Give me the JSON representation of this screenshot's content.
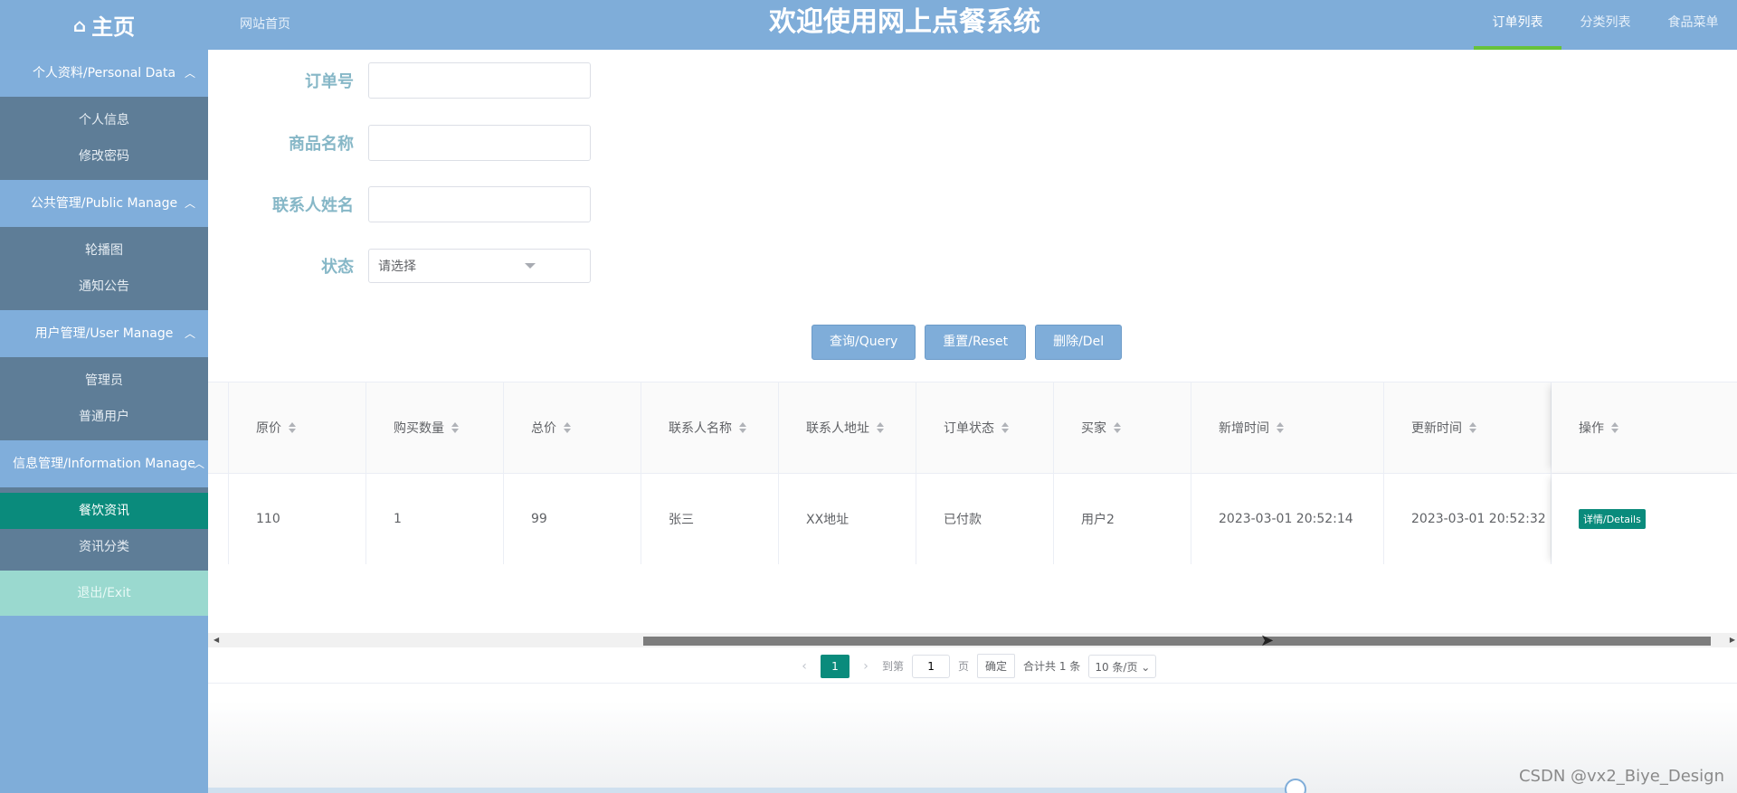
{
  "header": {
    "brand": "主页",
    "brand_icon": "home-icon",
    "site_link": "网站首页",
    "title": "欢迎使用网上点餐系统",
    "nav": [
      "订单列表",
      "分类列表",
      "食品菜单"
    ],
    "active_nav": "订单列表"
  },
  "sidebar": {
    "groups": [
      {
        "title": "个人资料/Personal Data",
        "items": [
          "个人信息",
          "修改密码"
        ]
      },
      {
        "title": "公共管理/Public Manage",
        "items": [
          "轮播图",
          "通知公告"
        ]
      },
      {
        "title": "用户管理/User Manage",
        "items": [
          "管理员",
          "普通用户"
        ]
      },
      {
        "title": "信息管理/Information Manage",
        "items": [
          "餐饮资讯",
          "资讯分类"
        ]
      }
    ],
    "active_item": "餐饮资讯",
    "exit": "退出/Exit"
  },
  "search": {
    "order_no_label": "订单号",
    "order_no_value": "",
    "product_label": "商品名称",
    "product_value": "",
    "contact_label": "联系人姓名",
    "contact_value": "",
    "status_label": "状态",
    "status_placeholder": "请选择"
  },
  "buttons": {
    "query": "查询/Query",
    "reset": "重置/Reset",
    "delete": "删除/Del"
  },
  "table": {
    "columns": [
      "原价",
      "购买数量",
      "总价",
      "联系人名称",
      "联系人地址",
      "订单状态",
      "买家",
      "新增时间",
      "更新时间",
      "操作"
    ],
    "rows": [
      {
        "original_price": "110",
        "quantity": "1",
        "total": "99",
        "contact_name": "张三",
        "contact_address": "XX地址",
        "status": "已付款",
        "buyer": "用户2",
        "created": "2023-03-01 20:52:14",
        "updated": "2023-03-01 20:52:32",
        "action": "详情/Details"
      }
    ]
  },
  "pagination": {
    "current": "1",
    "goto_label": "到第",
    "goto_value": "1",
    "page_unit": "页",
    "confirm": "确定",
    "total": "合计共 1 条",
    "page_size": "10 条/页"
  },
  "watermark": "CSDN @vx2_Biye_Design",
  "colors": {
    "primary": "#7fadd9",
    "accent": "#0a8b7c",
    "sidebar_sub": "#5e7d97",
    "exit_bg": "#9ad9cf"
  }
}
